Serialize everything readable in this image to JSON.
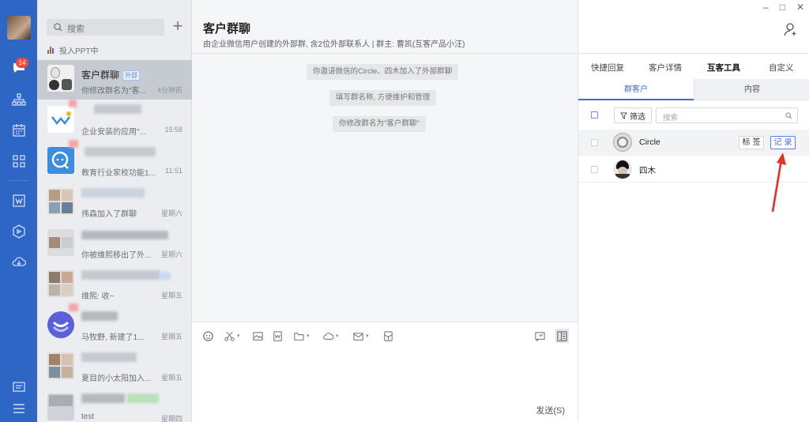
{
  "rail": {
    "badge": "14"
  },
  "conversation_list": {
    "search_placeholder": "搜索",
    "status": "投入PPT中",
    "items": [
      {
        "title": "客户群聊",
        "tag": "外部",
        "preview": "你修改群名为\"客...",
        "time": "4分钟前"
      },
      {
        "title": "",
        "preview": "企业安装的应用\"...",
        "time": "15:58"
      },
      {
        "title": "",
        "preview": "教育行业家校功能1...",
        "time": "11:51"
      },
      {
        "title": "",
        "preview": "伟森加入了群聊",
        "time": "星期六"
      },
      {
        "title": "",
        "preview": "你被维熙移出了外...",
        "time": "星期六"
      },
      {
        "title": "",
        "preview": "维熙: 收~",
        "time": "星期五"
      },
      {
        "title": "",
        "preview": "马牧野, 新建了1...",
        "time": "星期五"
      },
      {
        "title": "",
        "preview": "夏目的小太阳加入...",
        "time": "星期五"
      },
      {
        "title": "",
        "preview": "test",
        "time": "星期四"
      }
    ]
  },
  "chat": {
    "title": "客户群聊",
    "subtitle": "由企业微信用户创建的外部群, 含2位外部联系人 | 群主: 曹凯(互客产品小汪)",
    "system_messages": [
      "你邀请微信的Circle、四木加入了外部群聊",
      "填写群名称, 方便维护和管理",
      "你修改群名为\"客户群聊\""
    ],
    "send_label": "发送(S)"
  },
  "panel": {
    "tabs": [
      "快捷回复",
      "客户详情",
      "互客工具",
      "自定义"
    ],
    "active_tab": 2,
    "subtabs": [
      "群客户",
      "内容"
    ],
    "filter_label": "筛选",
    "search_placeholder": "搜索",
    "members": [
      {
        "name": "Circle",
        "tag_button": "标签",
        "record_button": "记录"
      },
      {
        "name": "四木"
      }
    ]
  },
  "colors": {
    "rail": "#2e66c6",
    "accent": "#3b6fd4",
    "arrow": "#e8302a",
    "badge": "#f44a3e"
  }
}
